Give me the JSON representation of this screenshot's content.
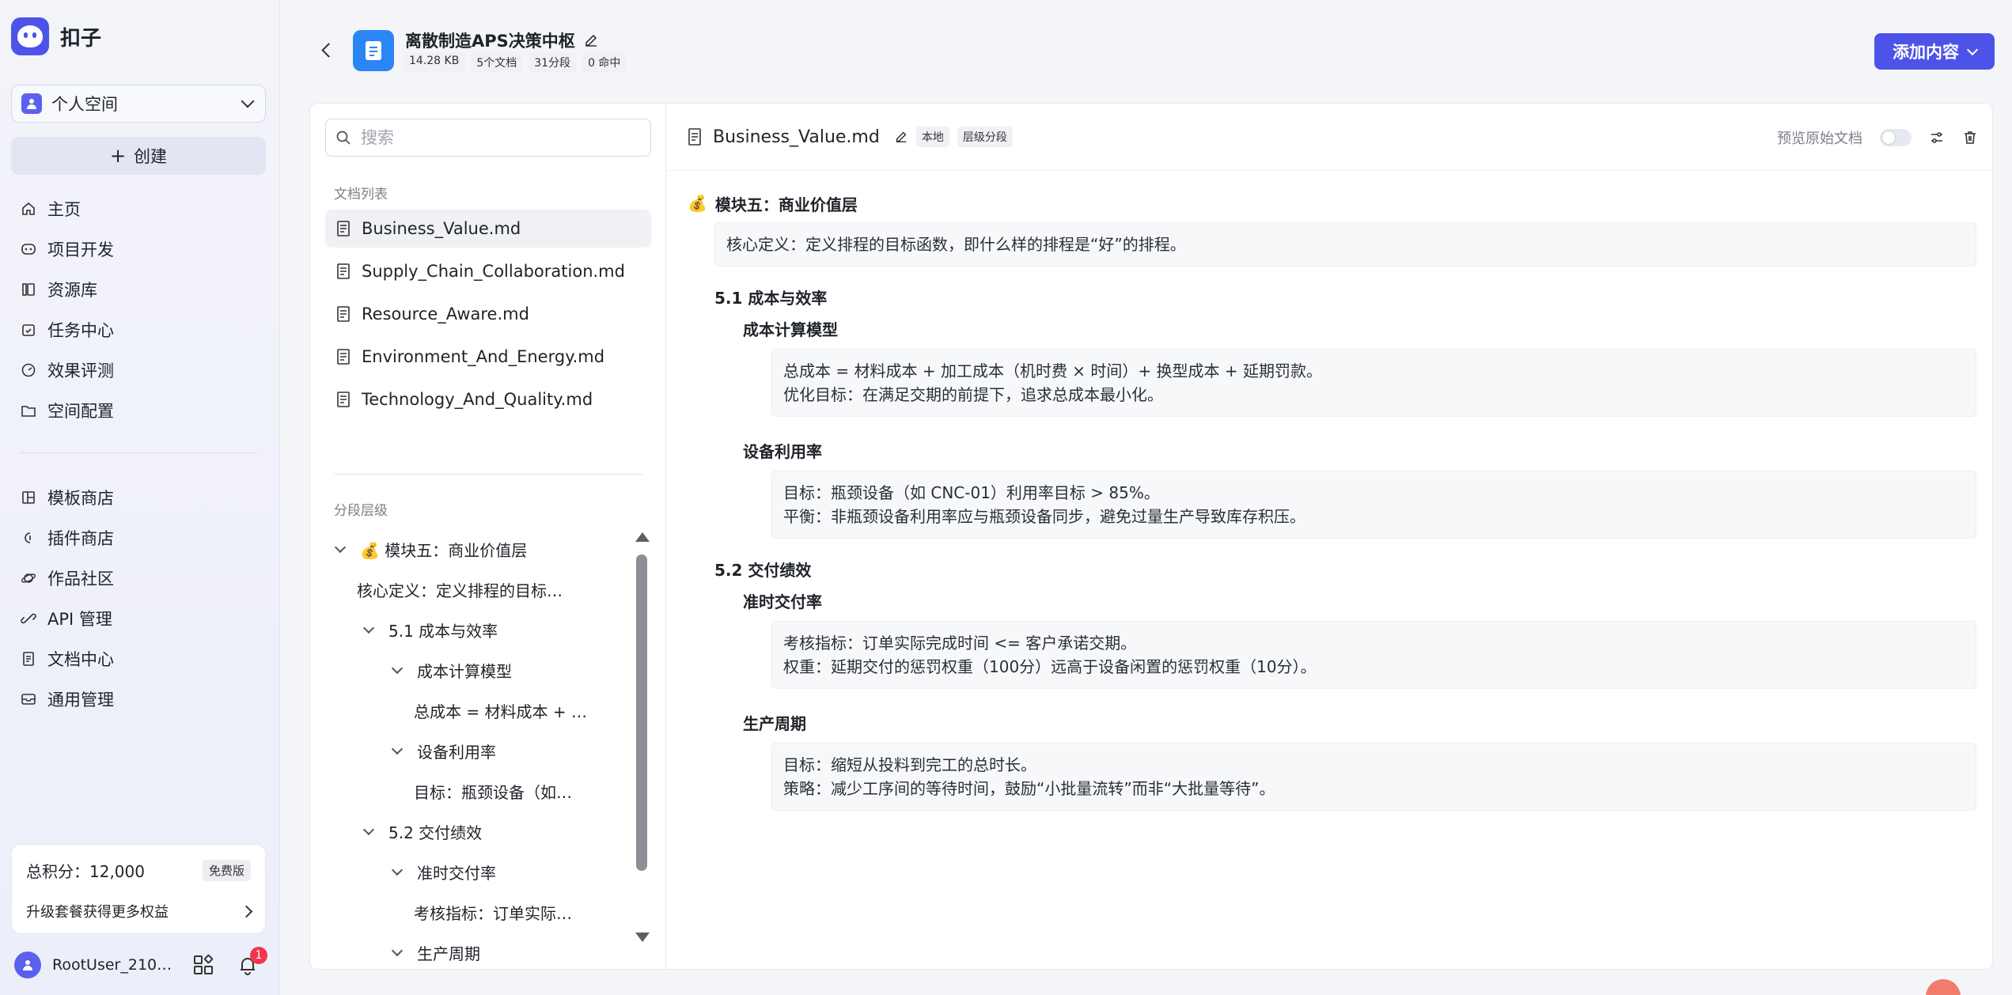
{
  "app": {
    "name": "扣子"
  },
  "space": {
    "label": "个人空间"
  },
  "create_label": "创建",
  "nav_main": [
    {
      "label": "主页",
      "icon": "home-icon"
    },
    {
      "label": "项目开发",
      "icon": "robot-icon"
    },
    {
      "label": "资源库",
      "icon": "library-icon"
    },
    {
      "label": "任务中心",
      "icon": "task-icon"
    },
    {
      "label": "效果评测",
      "icon": "gauge-icon"
    },
    {
      "label": "空间配置",
      "icon": "folder-settings-icon"
    }
  ],
  "nav_secondary": [
    {
      "label": "模板商店",
      "icon": "template-icon"
    },
    {
      "label": "插件商店",
      "icon": "plugin-icon"
    },
    {
      "label": "作品社区",
      "icon": "planet-icon"
    },
    {
      "label": "API 管理",
      "icon": "api-icon"
    },
    {
      "label": "文档中心",
      "icon": "doc-icon"
    },
    {
      "label": "通用管理",
      "icon": "inbox-icon"
    }
  ],
  "points": {
    "label": "总积分：12,000",
    "plan": "免费版",
    "upgrade": "升级套餐获得更多权益"
  },
  "user": {
    "name": "RootUser_210…",
    "notifications": "1"
  },
  "kb": {
    "title": "离散制造APS决策中枢",
    "tags": [
      "14.28 KB",
      "5个文档",
      "31分段",
      "0 命中"
    ]
  },
  "add_button": "添加内容",
  "search": {
    "placeholder": "搜索"
  },
  "doc_list_label": "文档列表",
  "docs": [
    "Business_Value.md",
    "Supply_Chain_Collaboration.md",
    "Resource_Aware.md",
    "Environment_And_Energy.md",
    "Technology_And_Quality.md"
  ],
  "segment_label": "分段层级",
  "tree": [
    {
      "text": "💰 模块五：商业价值层",
      "indent": 0,
      "caret": true
    },
    {
      "text": "核心定义：定义排程的目标…",
      "indent": 1,
      "caret": false
    },
    {
      "text": "5.1 成本与效率",
      "indent": 1,
      "caret": true
    },
    {
      "text": "成本计算模型",
      "indent": 2,
      "caret": true
    },
    {
      "text": "总成本 = 材料成本 + …",
      "indent": 3,
      "caret": false
    },
    {
      "text": "设备利用率",
      "indent": 2,
      "caret": true
    },
    {
      "text": "目标：瓶颈设备（如…",
      "indent": 3,
      "caret": false
    },
    {
      "text": "5.2 交付绩效",
      "indent": 1,
      "caret": true
    },
    {
      "text": "准时交付率",
      "indent": 2,
      "caret": true
    },
    {
      "text": "考核指标：订单实际…",
      "indent": 3,
      "caret": false
    },
    {
      "text": "生产周期",
      "indent": 2,
      "caret": true
    }
  ],
  "doc_view": {
    "name": "Business_Value.md",
    "tags": [
      "本地",
      "层级分段"
    ],
    "preview_label": "预览原始文档",
    "preview_enabled": false
  },
  "content": {
    "h1": "模块五：商业价值层",
    "h1_icon": "💰",
    "core": "核心定义：定义排程的目标函数，即什么样的排程是“好”的排程。",
    "s51": "5.1 成本与效率",
    "cost_model": "成本计算模型",
    "cost_l1": "总成本 = 材料成本 + 加工成本（机时费 × 时间）+ 换型成本 + 延期罚款。",
    "cost_l2": "优化目标：在满足交期的前提下，追求总成本最小化。",
    "util": "设备利用率",
    "util_l1": "目标：瓶颈设备（如 CNC-01）利用率目标 > 85%。",
    "util_l2": "平衡：非瓶颈设备利用率应与瓶颈设备同步，避免过量生产导致库存积压。",
    "s52": "5.2 交付绩效",
    "otd": "准时交付率",
    "otd_l1": "考核指标：订单实际完成时间 <= 客户承诺交期。",
    "otd_l2": "权重：延期交付的惩罚权重（100分）远高于设备闲置的惩罚权重（10分）。",
    "cycle": "生产周期",
    "cycle_l1": "目标：缩短从投料到完工的总时长。",
    "cycle_l2": "策略：减少工序间的等待时间，鼓励“小批量流转”而非“大批量等待”。"
  },
  "colors": {
    "accent": "#4d53e8",
    "kb_icon": "#2b86f5",
    "badge": "#f5364a"
  }
}
